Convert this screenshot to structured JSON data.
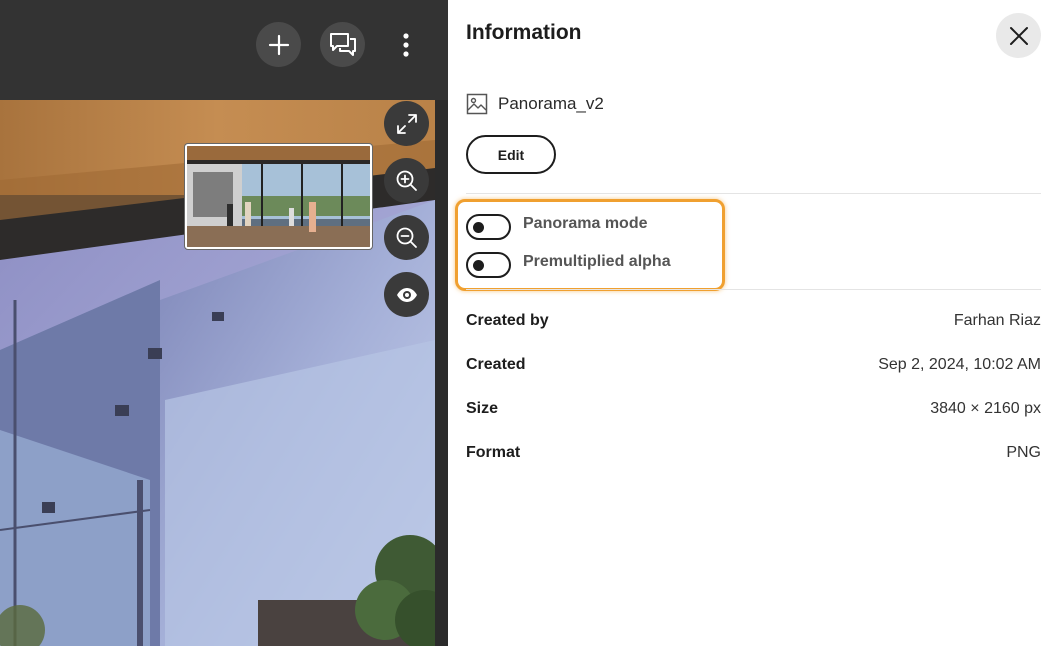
{
  "viewer": {
    "toolbar": {
      "add_icon": "plus-icon",
      "comments_icon": "chat-bubbles-icon",
      "menu_icon": "more-vertical-icon"
    },
    "side_controls": [
      "expand-icon",
      "zoom-in-icon",
      "zoom-out-icon",
      "eye-icon"
    ]
  },
  "panel": {
    "title": "Information",
    "close_icon": "close-icon",
    "file": {
      "icon": "image-icon",
      "name": "Panorama_v2"
    },
    "edit_label": "Edit",
    "toggles": [
      {
        "label": "Panorama mode",
        "on": false
      },
      {
        "label": "Premultiplied alpha",
        "on": false
      }
    ],
    "info": [
      {
        "key": "Created by",
        "value": "Farhan Riaz"
      },
      {
        "key": "Created",
        "value": "Sep 2, 2024, 10:02 AM"
      },
      {
        "key": "Size",
        "value": "3840 × 2160 px"
      },
      {
        "key": "Format",
        "value": "PNG"
      }
    ]
  },
  "colors": {
    "highlight": "#f0a030",
    "dark_bar": "#333333",
    "control_bg": "#3a3a3a"
  }
}
